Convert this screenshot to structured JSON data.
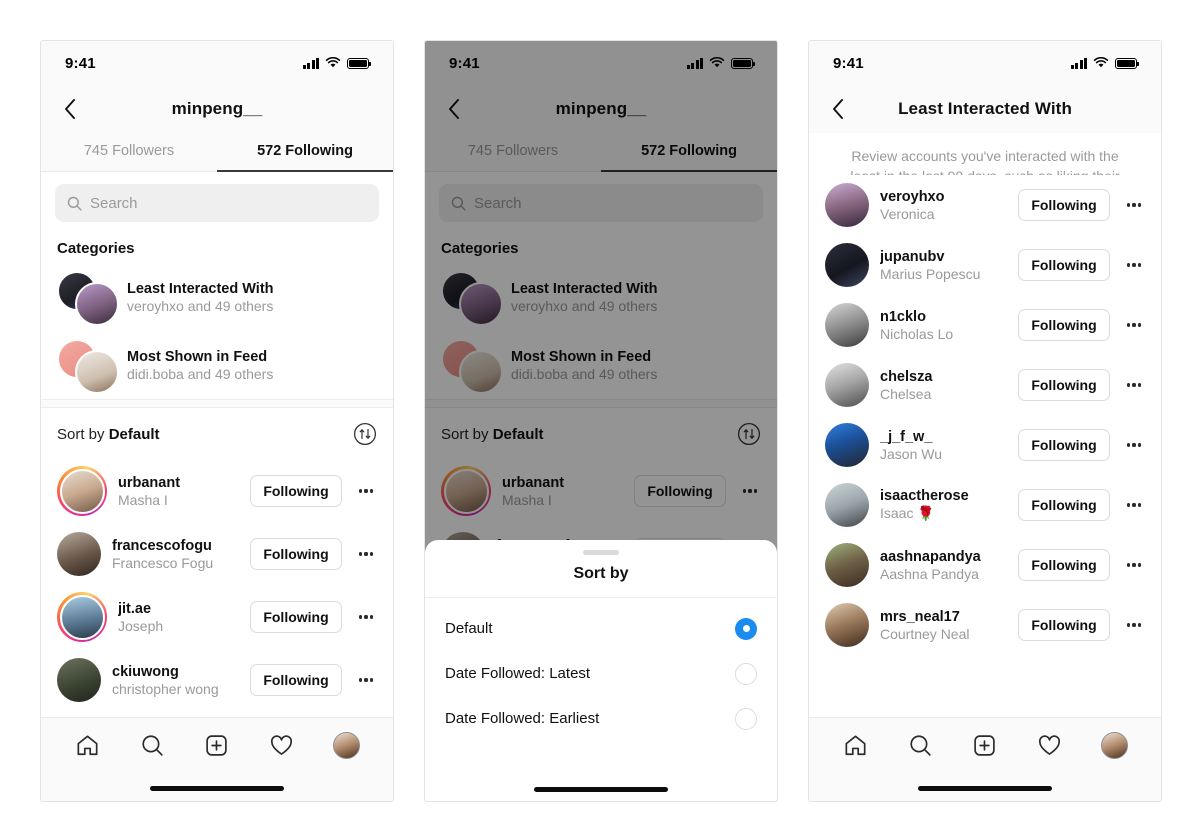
{
  "status_bar": {
    "time": "9:41",
    "icons": [
      "signal-icon",
      "wifi-icon",
      "battery-icon"
    ]
  },
  "profile": {
    "username": "minpeng__",
    "tabs": [
      {
        "label": "745 Followers",
        "active": false
      },
      {
        "label": "572 Following",
        "active": true
      }
    ],
    "search_placeholder": "Search",
    "categories_heading": "Categories",
    "categories": [
      {
        "title": "Least Interacted With",
        "subtitle": "veroyhxo and 49 others"
      },
      {
        "title": "Most Shown in Feed",
        "subtitle": "didi.boba and 49 others"
      }
    ],
    "sort_prefix": "Sort by",
    "sort_value": "Default",
    "following_label": "Following",
    "users": [
      {
        "username": "urbanant",
        "fullname": "Masha I",
        "has_story": true
      },
      {
        "username": "francescofogu",
        "fullname": "Francesco Fogu",
        "has_story": false
      },
      {
        "username": "jit.ae",
        "fullname": "Joseph",
        "has_story": true
      },
      {
        "username": "ckiuwong",
        "fullname": "christopher wong",
        "has_story": false
      }
    ]
  },
  "sort_sheet": {
    "title": "Sort by",
    "options": [
      {
        "label": "Default",
        "selected": true
      },
      {
        "label": "Date Followed: Latest",
        "selected": false
      },
      {
        "label": "Date Followed: Earliest",
        "selected": false
      }
    ]
  },
  "least_interacted": {
    "title": "Least Interacted With",
    "description": "Review accounts you've interacted with the least in the last 90 days, such as liking their posts or reacting to their stories.",
    "following_label": "Following",
    "users": [
      {
        "username": "veroyhxo",
        "fullname": "Veronica"
      },
      {
        "username": "jupanubv",
        "fullname": "Marius Popescu"
      },
      {
        "username": "n1cklo",
        "fullname": "Nicholas Lo"
      },
      {
        "username": "chelsza",
        "fullname": "Chelsea"
      },
      {
        "username": "_j_f_w_",
        "fullname": "Jason Wu"
      },
      {
        "username": "isaactherose",
        "fullname": "Isaac 🌹"
      },
      {
        "username": "aashnapandya",
        "fullname": "Aashna Pandya"
      },
      {
        "username": "mrs_neal17",
        "fullname": "Courtney Neal"
      }
    ]
  },
  "tabbar": {
    "items": [
      "home-icon",
      "search-icon",
      "create-icon",
      "activity-icon",
      "profile-avatar"
    ]
  },
  "colors": {
    "accent_blue": "#1a8cf0",
    "muted_text": "#9a9a9a",
    "primary_text": "#111111",
    "search_bg": "#efefef"
  }
}
